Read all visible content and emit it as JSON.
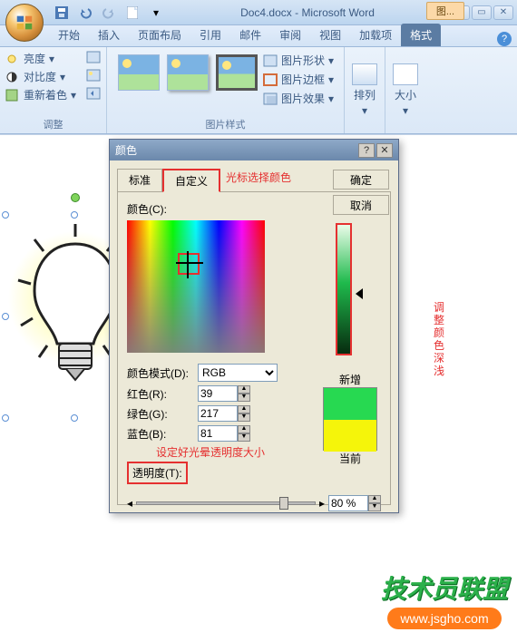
{
  "title": "Doc4.docx - Microsoft Word",
  "context_tab": "图...",
  "tabs": [
    "开始",
    "插入",
    "页面布局",
    "引用",
    "邮件",
    "审阅",
    "视图",
    "加载项",
    "格式"
  ],
  "ribbon": {
    "adjust": {
      "brightness": "亮度",
      "contrast": "对比度",
      "recolor": "重新着色",
      "label": "调整"
    },
    "styles_label": "图片样式",
    "shape": "图片形状",
    "border": "图片边框",
    "effects": "图片效果",
    "arrange": "排列",
    "size": "大小"
  },
  "dialog": {
    "title": "颜色",
    "tab_std": "标准",
    "tab_custom": "自定义",
    "ok": "确定",
    "cancel": "取消",
    "colors_label": "颜色(C):",
    "mode_label": "颜色模式(D):",
    "mode_value": "RGB",
    "red_label": "红色(R):",
    "red_value": "39",
    "green_label": "绿色(G):",
    "green_value": "217",
    "blue_label": "蓝色(B):",
    "blue_value": "81",
    "trans_label": "透明度(T):",
    "trans_value": "80 %",
    "new_label": "新增",
    "cur_label": "当前"
  },
  "annot": {
    "cursor": "光标选择颜色",
    "depth": "调整颜色深浅",
    "trans": "设定好光晕透明度大小"
  },
  "watermark": {
    "line1": "技术员联盟",
    "line2": "www.jsgho.com"
  }
}
